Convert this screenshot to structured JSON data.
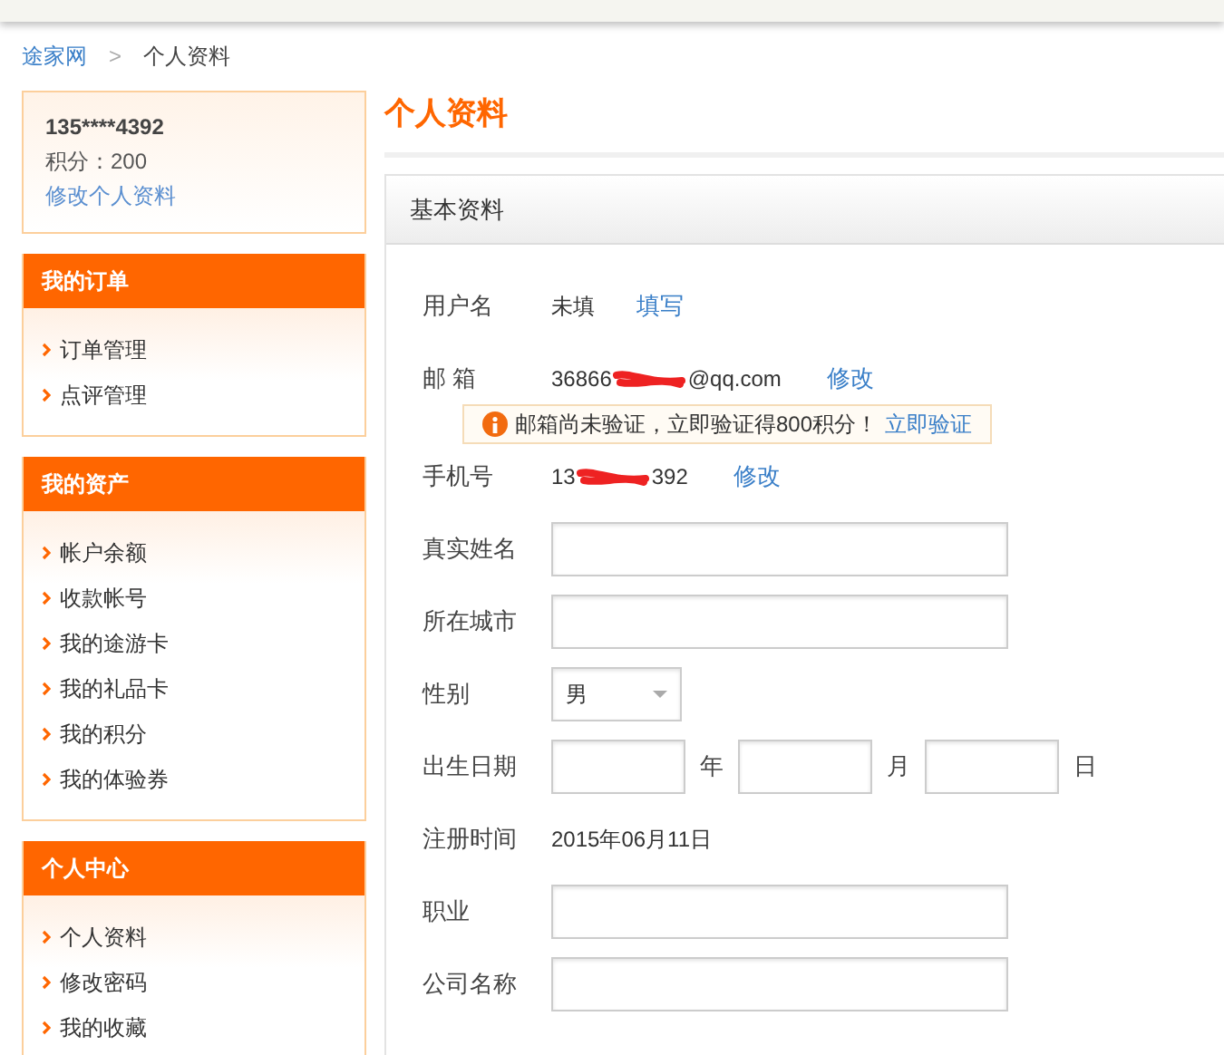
{
  "breadcrumb": [
    {
      "label": "途家网",
      "kind": "link"
    },
    {
      "label": ">",
      "kind": "separator"
    },
    {
      "label": "个人资料",
      "kind": "current"
    }
  ],
  "user_card": {
    "name": "135****4392",
    "points": "积分：200",
    "edit_link": "修改个人资料"
  },
  "sidebar": [
    {
      "title": "我的订单",
      "items": [
        "订单管理",
        "点评管理"
      ]
    },
    {
      "title": "我的资产",
      "items": [
        "帐户余额",
        "收款帐号",
        "我的途游卡",
        "我的礼品卡",
        "我的积分",
        "我的体验券"
      ]
    },
    {
      "title": "个人中心",
      "items": [
        "个人资料",
        "修改密码",
        "我的收藏"
      ]
    }
  ],
  "page_title": "个人资料",
  "panel_title": "基本资料",
  "fields": [
    {
      "kind": "text",
      "label": "用户名",
      "value": "未填",
      "action": "填写"
    },
    {
      "kind": "redacted",
      "label": "邮 箱",
      "value_start": "36866",
      "value_end": "@qq.com",
      "action": "修改",
      "notice": {
        "text": "邮箱尚未验证，立即验证得800积分！",
        "link": "立即验证"
      }
    },
    {
      "kind": "redacted",
      "label": "手机号",
      "value_start": "13",
      "value_end": "392",
      "action": "修改"
    },
    {
      "kind": "input",
      "label": "真实姓名"
    },
    {
      "kind": "input",
      "label": "所在城市"
    },
    {
      "kind": "select",
      "label": "性别",
      "value": "男"
    },
    {
      "kind": "date",
      "label": "出生日期",
      "units": [
        "年",
        "月",
        "日"
      ]
    },
    {
      "kind": "text",
      "label": "注册时间",
      "value": "2015年06月11日"
    },
    {
      "kind": "input",
      "label": "职业"
    },
    {
      "kind": "input",
      "label": "公司名称"
    }
  ]
}
